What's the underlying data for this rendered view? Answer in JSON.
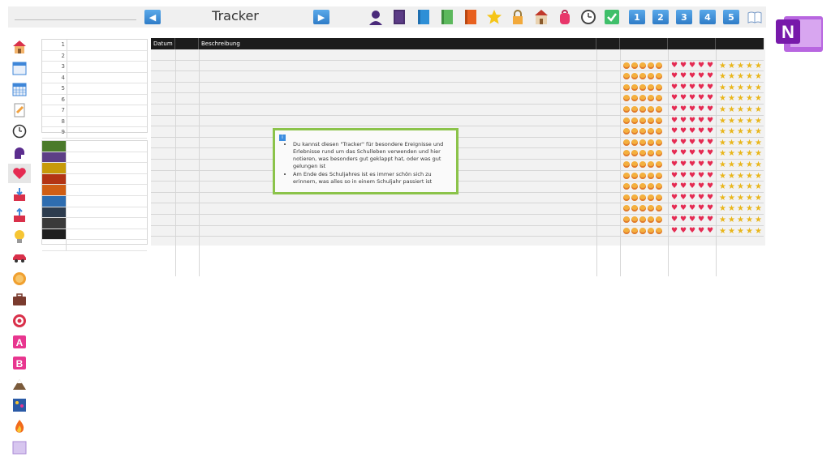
{
  "header": {
    "title": "Tracker",
    "prev_symbol": "◀",
    "next_symbol": "▶",
    "toolbar_icons": [
      "person-icon",
      "notebook-purple-icon",
      "notebook-blue-icon",
      "notebook-green-icon",
      "notebook-orange-icon",
      "star-icon",
      "lock-icon",
      "school-icon",
      "backpack-icon",
      "clock-icon",
      "checkmark-icon"
    ],
    "numbered_tabs": [
      "1",
      "2",
      "3",
      "4",
      "5"
    ],
    "book_icon": "book-icon"
  },
  "logo": {
    "name": "onenote-logo-icon",
    "letter": "N"
  },
  "sidebar": {
    "items": [
      {
        "name": "house-icon",
        "color": "#f08a3a"
      },
      {
        "name": "calendar-icon",
        "color": "#3e86d8"
      },
      {
        "name": "calendar-grid-icon",
        "color": "#3e86d8"
      },
      {
        "name": "document-edit-icon",
        "color": "#f2a23f"
      },
      {
        "name": "clock-icon",
        "color": "#555555"
      },
      {
        "name": "person-brain-icon",
        "color": "#5b2d8e"
      },
      {
        "name": "heart-icon",
        "color": "#e52b52",
        "active": true
      },
      {
        "name": "tray-download-icon",
        "color": "#d9304a"
      },
      {
        "name": "tray-upload-icon",
        "color": "#d9304a"
      },
      {
        "name": "lightbulb-icon",
        "color": "#f6c533"
      },
      {
        "name": "car-icon",
        "color": "#d9304a"
      },
      {
        "name": "coin-icon",
        "color": "#f0a030"
      },
      {
        "name": "briefcase-icon",
        "color": "#7a3b2e"
      },
      {
        "name": "target-icon",
        "color": "#d9304a"
      },
      {
        "name": "letter-a-icon",
        "color": "#e8368f",
        "text": "A"
      },
      {
        "name": "letter-b-icon",
        "color": "#e8368f",
        "text": "B"
      },
      {
        "name": "mountain-icon",
        "color": "#7a5a3a"
      },
      {
        "name": "fireworks-icon",
        "color": "#3e86d8"
      },
      {
        "name": "fire-icon",
        "color": "#f26a1b"
      },
      {
        "name": "blank-page-icon",
        "color": "#c9b6e4"
      }
    ]
  },
  "number_list": [
    "1",
    "2",
    "3",
    "4",
    "5",
    "6",
    "7",
    "8",
    "9"
  ],
  "color_list": [
    "#4b7a2b",
    "#5d3f86",
    "#c79a09",
    "#b33414",
    "#d05e14",
    "#2e6db0",
    "#2d3c4e",
    "#3a3a3a",
    "#1f1f1f"
  ],
  "table": {
    "headers": [
      "Datum",
      "",
      "Beschreibung",
      "",
      "",
      "",
      ""
    ],
    "row_count": 17
  },
  "info": {
    "icon": "info-icon",
    "bullets": [
      "Du kannst diesen \"Tracker\" für besondere Ereignisse und Erlebnisse rund um das Schulleben verwenden und hier notieren, was besonders gut geklappt hat, oder was gut gelungen ist",
      "Am Ende des Schuljahres ist es immer schön sich zu erinnern, was alles so in einem Schuljahr passiert ist"
    ]
  }
}
